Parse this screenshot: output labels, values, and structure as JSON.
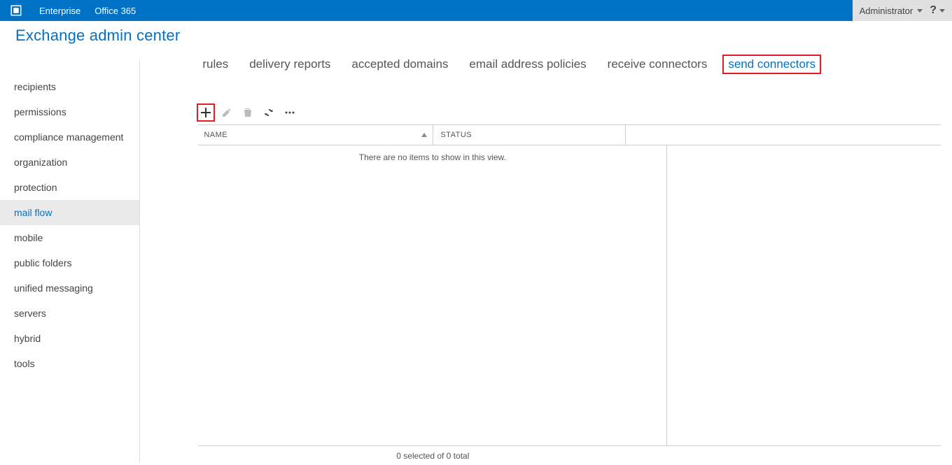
{
  "topbar": {
    "links": [
      {
        "label": "Enterprise"
      },
      {
        "label": "Office 365"
      }
    ],
    "admin_label": "Administrator",
    "help_glyph": "?"
  },
  "app_title": "Exchange admin center",
  "sidebar": {
    "items": [
      {
        "label": "recipients",
        "active": false
      },
      {
        "label": "permissions",
        "active": false
      },
      {
        "label": "compliance management",
        "active": false
      },
      {
        "label": "organization",
        "active": false
      },
      {
        "label": "protection",
        "active": false
      },
      {
        "label": "mail flow",
        "active": true
      },
      {
        "label": "mobile",
        "active": false
      },
      {
        "label": "public folders",
        "active": false
      },
      {
        "label": "unified messaging",
        "active": false
      },
      {
        "label": "servers",
        "active": false
      },
      {
        "label": "hybrid",
        "active": false
      },
      {
        "label": "tools",
        "active": false
      }
    ]
  },
  "subtabs": [
    {
      "label": "rules",
      "active": false
    },
    {
      "label": "delivery reports",
      "active": false
    },
    {
      "label": "accepted domains",
      "active": false
    },
    {
      "label": "email address policies",
      "active": false
    },
    {
      "label": "receive connectors",
      "active": false
    },
    {
      "label": "send connectors",
      "active": true
    }
  ],
  "columns": {
    "name": "NAME",
    "status": "STATUS"
  },
  "empty_text": "There are no items to show in this view.",
  "footer_text": "0 selected of 0 total"
}
